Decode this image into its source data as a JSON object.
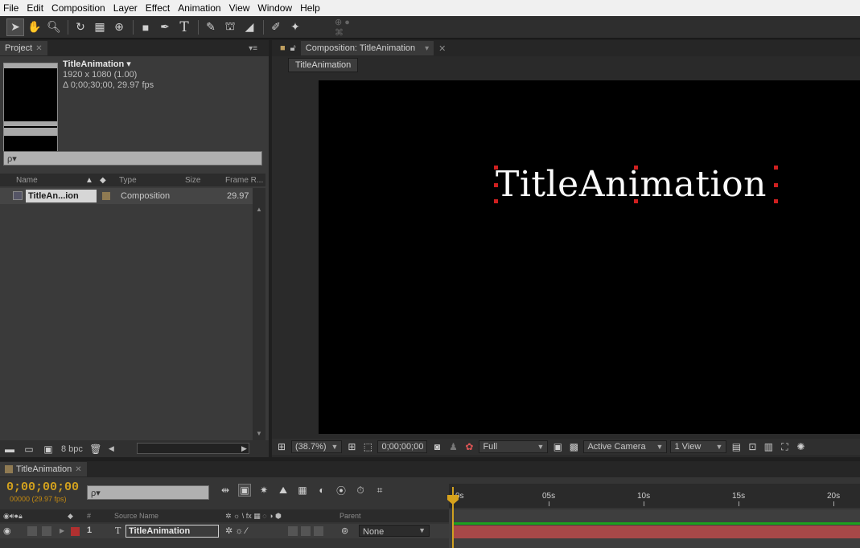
{
  "menu": [
    "File",
    "Edit",
    "Composition",
    "Layer",
    "Effect",
    "Animation",
    "View",
    "Window",
    "Help"
  ],
  "project": {
    "tab_label": "Project",
    "comp_name": "TitleAnimation",
    "comp_name_arrow": "▾",
    "resolution": "1920 x 1080 (1.00)",
    "duration": "Δ 0;00;30;00, 29.97 fps",
    "search_placeholder": "ρ▾",
    "columns": {
      "name": "Name",
      "type": "Type",
      "size": "Size",
      "frame_rate": "Frame R..."
    },
    "row": {
      "name": "TitleAn...ion",
      "type": "Composition",
      "frame_rate": "29.97"
    },
    "bpc": "8 bpc"
  },
  "composition": {
    "tab_label": "Composition: TitleAnimation",
    "sub_tab": "TitleAnimation",
    "viewer_text": "TitleAnimation",
    "zoom": "(38.7%)",
    "timecode": "0;00;00;00",
    "resolution": "Full",
    "camera": "Active Camera",
    "views": "1 View"
  },
  "timeline": {
    "tab_label": "TitleAnimation",
    "timecode": "0;00;00;00",
    "frames": "00000 (29.97 fps)",
    "search_placeholder": "ρ▾",
    "columns": {
      "number": "#",
      "source_name": "Source Name",
      "parent": "Parent"
    },
    "ruler_marks": [
      "0s",
      "05s",
      "10s",
      "15s",
      "20s"
    ],
    "layer": {
      "index": "1",
      "type_icon": "T",
      "name": "TitleAnimation",
      "parent": "None"
    }
  },
  "colors": {
    "timecode": "#d2a11e",
    "layer_bar": "#a84848",
    "work_area": "#1ea01e",
    "label_red": "#b03030"
  }
}
